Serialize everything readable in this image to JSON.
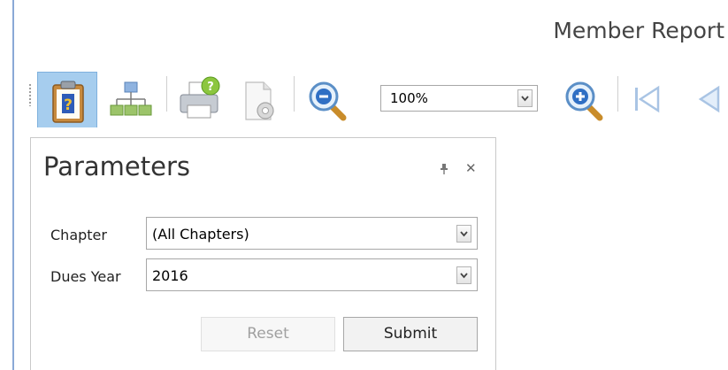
{
  "report": {
    "title": "Member Report"
  },
  "toolbar": {
    "zoom": {
      "value": "100%"
    },
    "icons": [
      "parameters-icon",
      "document-map-icon",
      "print-icon",
      "page-setup-icon",
      "zoom-out-icon",
      "zoom-in-icon",
      "first-page-icon",
      "previous-page-icon"
    ]
  },
  "parameters": {
    "title": "Parameters",
    "fields": [
      {
        "label": "Chapter",
        "value": "(All Chapters)"
      },
      {
        "label": "Dues Year",
        "value": "2016"
      }
    ],
    "reset_label": "Reset",
    "submit_label": "Submit"
  },
  "colors": {
    "active_button": "#a6cdee",
    "accent_rule": "#8aa9d6"
  }
}
